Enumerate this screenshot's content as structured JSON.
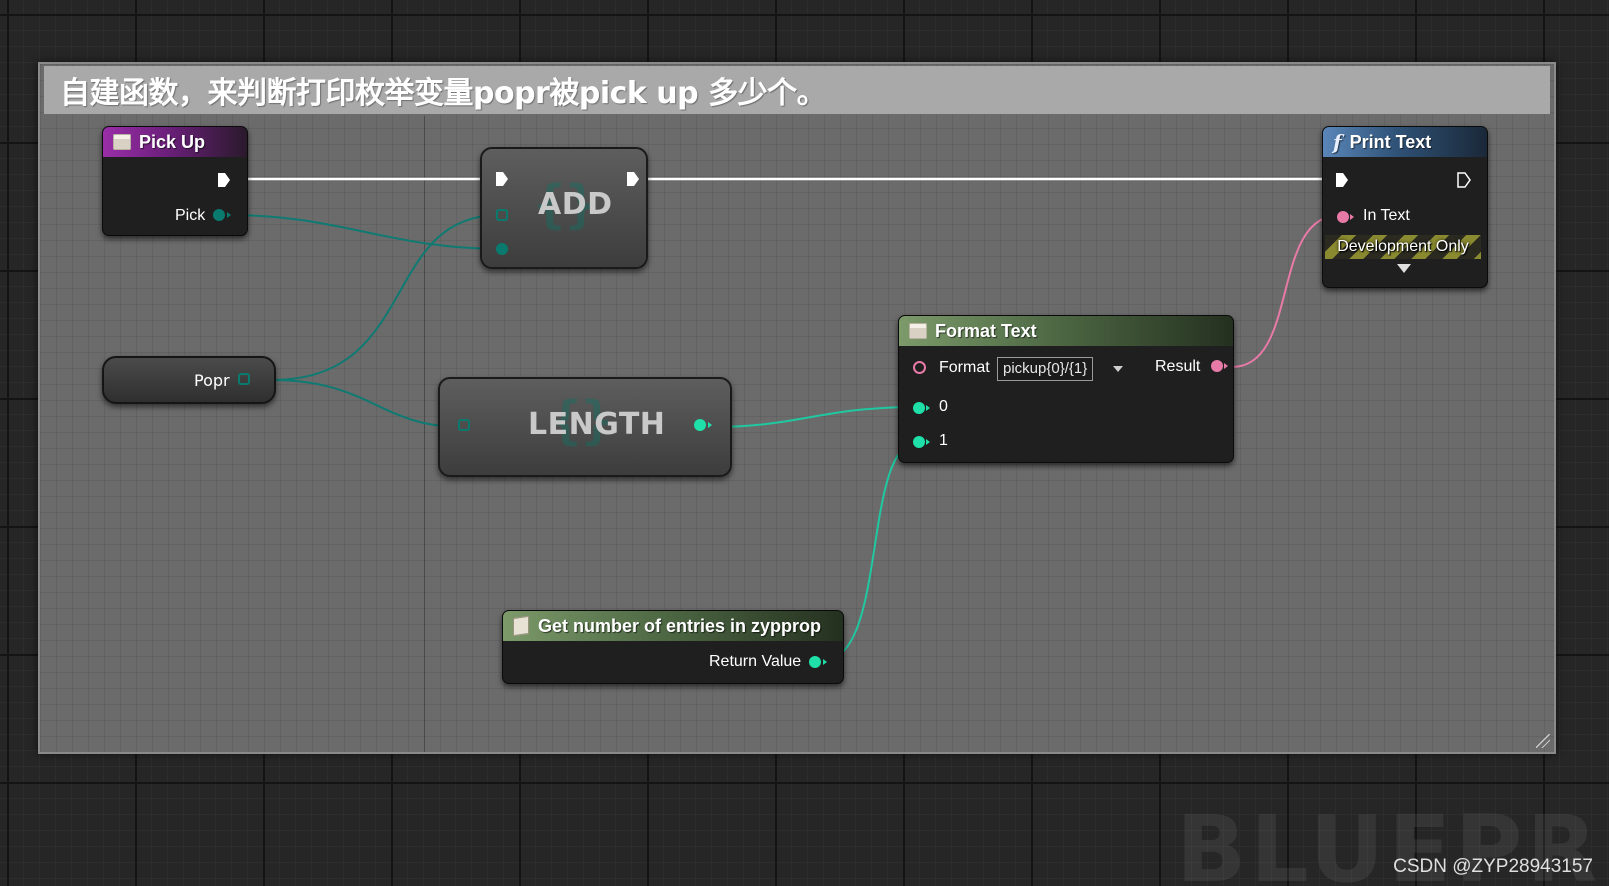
{
  "comment": {
    "title": "自建函数，来判断打印枚举变量popr被pick up 多少个。"
  },
  "nodes": {
    "pick_up": {
      "title": "Pick Up",
      "output_label": "Pick"
    },
    "add": {
      "title": "ADD"
    },
    "popr": {
      "label": "Popr"
    },
    "length": {
      "title": "LENGTH"
    },
    "format_text": {
      "title": "Format Text",
      "format_label": "Format",
      "format_value": "pickup{0}/{1}",
      "result_label": "Result",
      "input_0": "0",
      "input_1": "1"
    },
    "print_text": {
      "title": "Print Text",
      "in_text_label": "In Text",
      "dev_only_label": "Development Only"
    },
    "get_entries": {
      "title": "Get number of entries in zypprop",
      "return_label": "Return Value"
    }
  },
  "watermark": {
    "background_text": "BLUEPRINT",
    "credit": "CSDN @ZYP28943157"
  },
  "colors": {
    "exec_wire": "#ffffff",
    "int_pin": "#1fe0a8",
    "enum_pin": "#0a7a6e",
    "text_pin": "#e87aa8",
    "comment_bg": "#6b6b6b",
    "comment_header": "#a9a9a9"
  },
  "icons": {
    "event_icon": "event-icon",
    "function_icon": "function-icon",
    "macro_icon": "macro-icon"
  }
}
